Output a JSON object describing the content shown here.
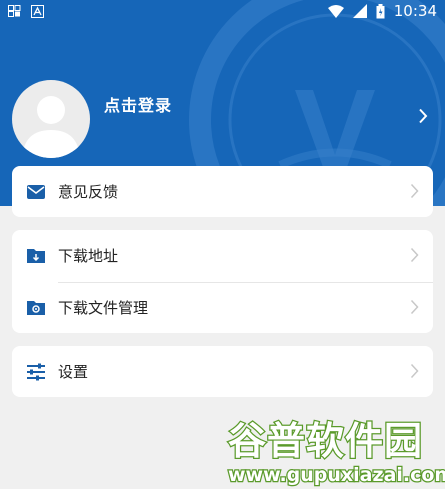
{
  "status_bar": {
    "time": "10:34",
    "left_icons": [
      "gallery-icon",
      "a-icon"
    ],
    "right_icons": [
      "wifi-icon",
      "signal-icon",
      "battery-icon"
    ]
  },
  "profile": {
    "login_label": "点击登录"
  },
  "menu": {
    "feedback": {
      "label": "意见反馈",
      "icon": "mail-icon"
    },
    "download_address": {
      "label": "下载地址",
      "icon": "folder-download-icon"
    },
    "download_manage": {
      "label": "下载文件管理",
      "icon": "folder-settings-icon"
    },
    "settings": {
      "label": "设置",
      "icon": "sliders-icon"
    }
  },
  "watermark": {
    "title": "谷普软件园",
    "url": "www.gupuxiazai.com"
  },
  "colors": {
    "header": "#1666b8",
    "icon": "#1a5fa8",
    "background": "#f0f0f0",
    "watermark_green": "#5a9a2a"
  }
}
